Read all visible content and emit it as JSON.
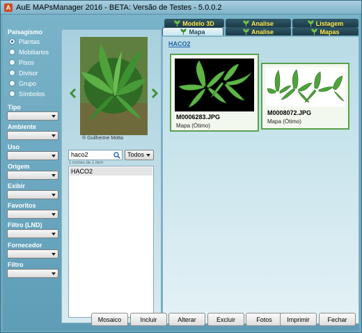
{
  "window": {
    "title": "AuE MAPsManager 2016  - BETA: Versão de Testes - 5.0.0.2",
    "icon_label": "A"
  },
  "sidebar": {
    "paisagismo_title": "Paisagismo",
    "radio_items": [
      {
        "label": "Plantas",
        "selected": true
      },
      {
        "label": "Mobiliarios",
        "selected": false
      },
      {
        "label": "Pisos",
        "selected": false
      },
      {
        "label": "Divisor",
        "selected": false
      },
      {
        "label": "Grupo",
        "selected": false
      },
      {
        "label": "Símbolos",
        "selected": false
      }
    ],
    "filters": [
      {
        "label": "Tipo"
      },
      {
        "label": "Ambiente"
      },
      {
        "label": "Uso"
      },
      {
        "label": "Origem"
      },
      {
        "label": "Exibir"
      },
      {
        "label": "Favoritos"
      },
      {
        "label": "Filtro (LND)"
      },
      {
        "label": "Fornecedor"
      },
      {
        "label": "Filtro"
      }
    ]
  },
  "center": {
    "photo_credit": "® Guilherme Motta",
    "search_value": "haco2",
    "scope_value": "Todos",
    "count_text": "1 nomes de 1 item",
    "list_items": [
      "HACO2"
    ]
  },
  "tabs": {
    "top_row": [
      "Modelo 3D",
      "Analise",
      "Listagem"
    ],
    "bottom_row": [
      "Mapa",
      "Analise",
      "Mapas"
    ]
  },
  "main": {
    "section_title": "HACO2",
    "cards": [
      {
        "name": "M0006283.JPG",
        "status": "Mapa (Ótimo)"
      },
      {
        "name": "M0008072.JPG",
        "status": "Mapa (Ótimo)"
      }
    ]
  },
  "buttons": [
    "Mosaico",
    "Incluir",
    "Alterar",
    "Excluir",
    "Fotos",
    "Imprimir",
    "Fechar"
  ],
  "colors": {
    "tab_text": "#ffe64a",
    "card_border": "#58a14a",
    "link": "#1f5fa8"
  }
}
